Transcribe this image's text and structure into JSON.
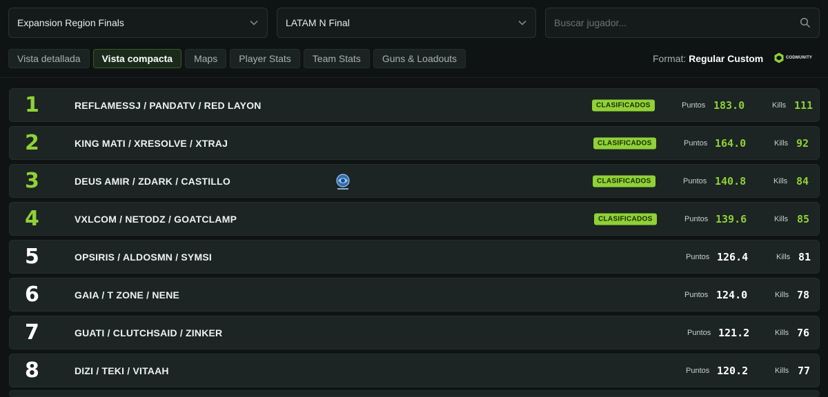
{
  "filters": {
    "region": "Expansion Region Finals",
    "stage": "LATAM N Final",
    "search_placeholder": "Buscar jugador..."
  },
  "tabs": [
    {
      "label": "Vista detallada",
      "active": false
    },
    {
      "label": "Vista compacta",
      "active": true
    },
    {
      "label": "Maps",
      "active": false
    },
    {
      "label": "Player Stats",
      "active": false
    },
    {
      "label": "Team Stats",
      "active": false
    },
    {
      "label": "Guns & Loadouts",
      "active": false
    }
  ],
  "format": {
    "label": "Format:",
    "value": "Regular Custom"
  },
  "brand": {
    "name": "CODMUNITY"
  },
  "columns": {
    "points_label": "Puntos",
    "kills_label": "Kills"
  },
  "qualified_label": "CLASIFICADOS",
  "colors": {
    "accent": "#8fd136",
    "background": "#0f1313",
    "row": "#1c2424"
  },
  "standings": [
    {
      "rank": "1",
      "team": "REFLAMESSJ / PANDATV / RED LAYON",
      "qualified": true,
      "points": "183.0",
      "kills": "111"
    },
    {
      "rank": "2",
      "team": "KING MATI / XRESOLVE / XTRAJ",
      "qualified": true,
      "points": "164.0",
      "kills": "92"
    },
    {
      "rank": "3",
      "team": "DEUS AMIR / ZDARK / CASTILLO",
      "qualified": true,
      "points": "140.8",
      "kills": "84",
      "has_logo": true
    },
    {
      "rank": "4",
      "team": "VXLCOM / NETODZ / GOATCLAMP",
      "qualified": true,
      "points": "139.6",
      "kills": "85"
    },
    {
      "rank": "5",
      "team": "OPSIRIS / ALDOSMN / SYMSI",
      "qualified": false,
      "points": "126.4",
      "kills": "81"
    },
    {
      "rank": "6",
      "team": "GAIA / T ZONE / NENE",
      "qualified": false,
      "points": "124.0",
      "kills": "78"
    },
    {
      "rank": "7",
      "team": "GUATI / CLUTCHSAID / ZINKER",
      "qualified": false,
      "points": "121.2",
      "kills": "76"
    },
    {
      "rank": "8",
      "team": "DIZI / TEKI / VITAAH",
      "qualified": false,
      "points": "120.2",
      "kills": "77"
    }
  ]
}
